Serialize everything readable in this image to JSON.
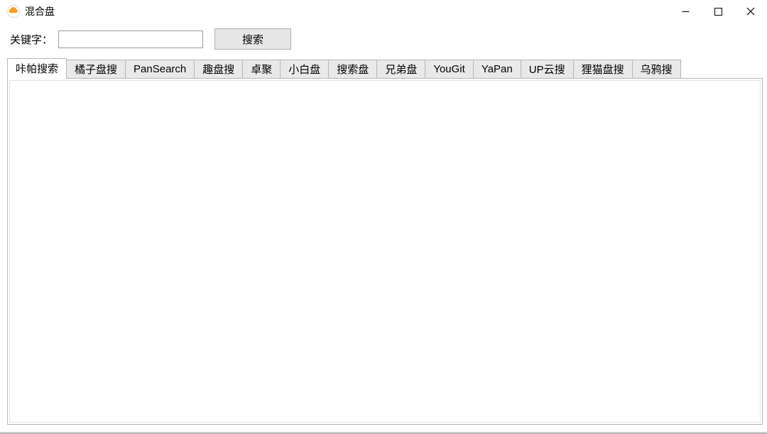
{
  "window": {
    "title": "混合盘"
  },
  "search": {
    "label": "关键字：",
    "value": "",
    "button": "搜索"
  },
  "tabs": {
    "active_index": 0,
    "items": [
      {
        "label": "咔帕搜索"
      },
      {
        "label": "橘子盘搜"
      },
      {
        "label": "PanSearch"
      },
      {
        "label": "趣盘搜"
      },
      {
        "label": "卓聚"
      },
      {
        "label": "小白盘"
      },
      {
        "label": "搜索盘"
      },
      {
        "label": "兄弟盘"
      },
      {
        "label": "YouGit"
      },
      {
        "label": "YaPan"
      },
      {
        "label": "UP云搜"
      },
      {
        "label": "狸猫盘搜"
      },
      {
        "label": "乌鸦搜"
      }
    ]
  }
}
